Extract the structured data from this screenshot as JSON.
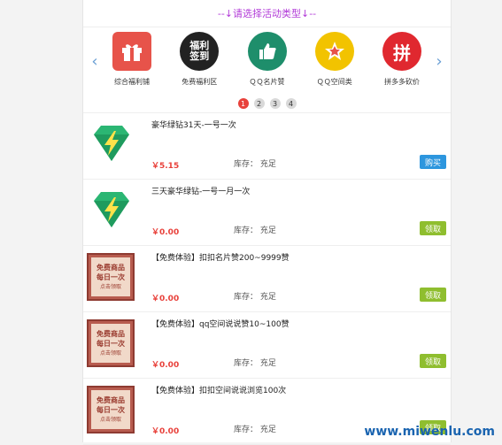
{
  "header": {
    "category_prompt": "--↓请选择活动类型↓--"
  },
  "categories": [
    {
      "label": "综合福利铺",
      "icon": "gift-icon",
      "color": "#e7534a"
    },
    {
      "label": "免费福利区",
      "icon": "welfare-checkin-icon",
      "color": "#222222",
      "text": "福利签到"
    },
    {
      "label": "ＱＱ名片赞",
      "icon": "thumbs-up-icon",
      "color": "#1e8e6b"
    },
    {
      "label": "ＱＱ空间类",
      "icon": "star-icon",
      "color": "#f2c300"
    },
    {
      "label": "拼多多砍价",
      "icon": "pinduoduo-icon",
      "color": "#e0282f",
      "text": "拼"
    }
  ],
  "carousel": {
    "pages": [
      "1",
      "2",
      "3",
      "4"
    ],
    "active_index": 0
  },
  "products": [
    {
      "title": "豪华绿钻31天-一号一次",
      "price": "￥5.15",
      "stock": "库存： 充足",
      "action": "购买",
      "action_type": "buy",
      "thumb": "green-diamond-icon"
    },
    {
      "title": "三天豪华绿钻-一号一月一次",
      "price": "￥0.00",
      "stock": "库存： 充足",
      "action": "领取",
      "action_type": "claim",
      "thumb": "green-diamond-icon"
    },
    {
      "title": "【免费体验】扣扣名片赞200~9999赞",
      "price": "￥0.00",
      "stock": "库存： 充足",
      "action": "领取",
      "action_type": "claim",
      "thumb": "free-stamp-icon"
    },
    {
      "title": "【免费体验】qq空间说说赞10~100赞",
      "price": "￥0.00",
      "stock": "库存： 充足",
      "action": "领取",
      "action_type": "claim",
      "thumb": "free-stamp-icon"
    },
    {
      "title": "【免费体验】扣扣空间说说浏览100次",
      "price": "￥0.00",
      "stock": "库存： 充足",
      "action": "领取",
      "action_type": "claim",
      "thumb": "free-stamp-icon"
    }
  ],
  "free_stamp": {
    "line1": "免费商品",
    "line2": "每日一次",
    "line3": "点击领取"
  },
  "watermark": "www.miwenlu.com",
  "colors": {
    "accent_red": "#e8413b",
    "buy_blue": "#2d96de",
    "claim_green": "#8fbe2f",
    "prompt_purple": "#b23bd8"
  }
}
